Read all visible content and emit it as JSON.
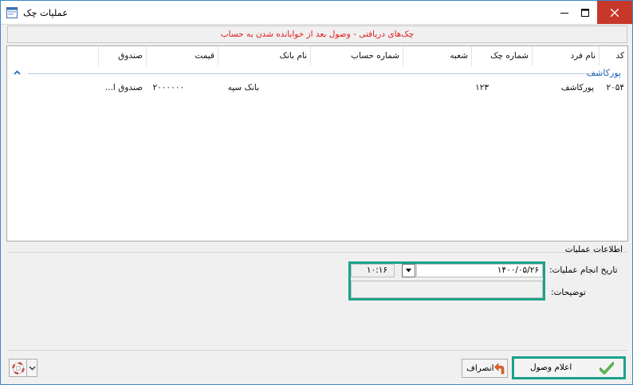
{
  "window": {
    "title": "عملیات چک",
    "colors": {
      "border": "#3c87c9",
      "close": "#c7372a",
      "accent": "#1ba28a",
      "banner_text": "#e0201b",
      "group_text": "#1f5fb3"
    }
  },
  "banner": {
    "text": "چک‌های دریافتی - وصول بعد از خوابانده شدن به حساب"
  },
  "list": {
    "columns": [
      "کد",
      "نام فرد",
      "شماره چک",
      "شعبه",
      "شماره حساب",
      "نام بانک",
      "قیمت",
      "صندوق"
    ],
    "group": "پورکاشف",
    "row": {
      "code": "۲۰۵۴",
      "person": "پورکاشف",
      "check_no": "۱۲۳",
      "branch": "",
      "account": "",
      "bank": "بانک سپه",
      "amount": "۲۰۰۰۰۰۰",
      "fund": "صندوق ا..."
    }
  },
  "info": {
    "title": "اطلاعات عملیات",
    "date_label": "تاریخ انجام عملیات:",
    "date_value": "۱۴۰۰/۰۵/۲۶",
    "time_value": "۱۰:۱۶",
    "desc_label": "توضیحات:",
    "desc_value": ""
  },
  "buttons": {
    "cancel": "انصراف",
    "ok": "اعلام وصول"
  },
  "icons": {
    "app": "window-form-icon",
    "minimize": "minimize-icon",
    "maximize": "maximize-icon",
    "close": "close-icon",
    "collapse": "chevron-up-icon",
    "dropdown": "dropdown-arrow-icon",
    "help": "lifebuoy-icon",
    "cancel": "undo-arrow-icon",
    "ok": "checkmark-icon"
  }
}
